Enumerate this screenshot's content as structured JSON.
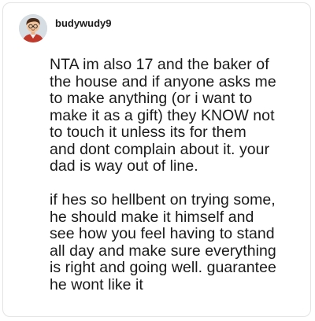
{
  "post": {
    "username": "budywudy9",
    "avatar_icon": "cartoon-person-avatar-icon",
    "paragraphs": [
      "NTA im also 17 and the baker of\nthe house and if anyone asks me\nto make anything (or i want to\nmake it as a gift) they KNOW not\nto touch it unless its for them\nand dont complain about it. your\ndad is way out of line.",
      "if hes so hellbent on trying some,\nhe should make it himself and\nsee how you feel having to stand\nall day and make sure everything\nis right and going well. guarantee\nhe wont like it"
    ]
  }
}
